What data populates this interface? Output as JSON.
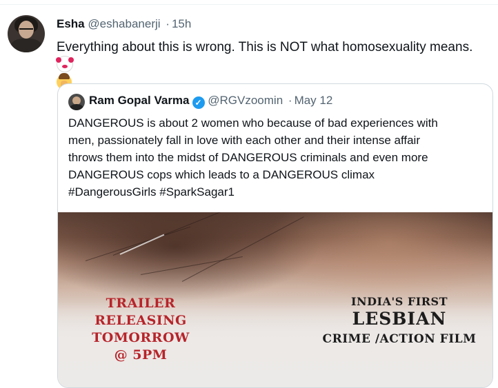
{
  "tweet": {
    "author_name": "Esha",
    "author_handle": "@eshabanerji",
    "time": "15h",
    "separator": "·",
    "text": "Everything about this is wrong. This is NOT what homosexuality means.",
    "emoji_1": "clown-face-emoji",
    "emoji_2": "facepalm-emoji"
  },
  "quoted_tweet": {
    "author_name": "Ram Gopal Varma",
    "verified_icon": "verified-badge-icon",
    "author_handle": "@RGVzoomin",
    "separator": "·",
    "date": "May 12",
    "text_lines": [
      "DANGEROUS is about 2 women who because of bad experiences with",
      "men, passionately fall in love with each other and their intense affair",
      "throws them into the midst of DANGEROUS criminals and even more",
      "DANGEROUS cops which leads to a DANGEROUS climax",
      "#DangerousGirls #SparkSagar1"
    ]
  },
  "poster": {
    "left_lines": [
      "TRAILER",
      "RELEASING",
      "TOMORROW",
      "@ 5PM"
    ],
    "right_line_1": "INDIA'S FIRST",
    "right_line_2": "LESBIAN",
    "right_line_3": "CRIME /ACTION FILM"
  },
  "colors": {
    "accent_blue": "#1d9bf0",
    "poster_red": "#b7242a",
    "muted_text": "#536471"
  }
}
